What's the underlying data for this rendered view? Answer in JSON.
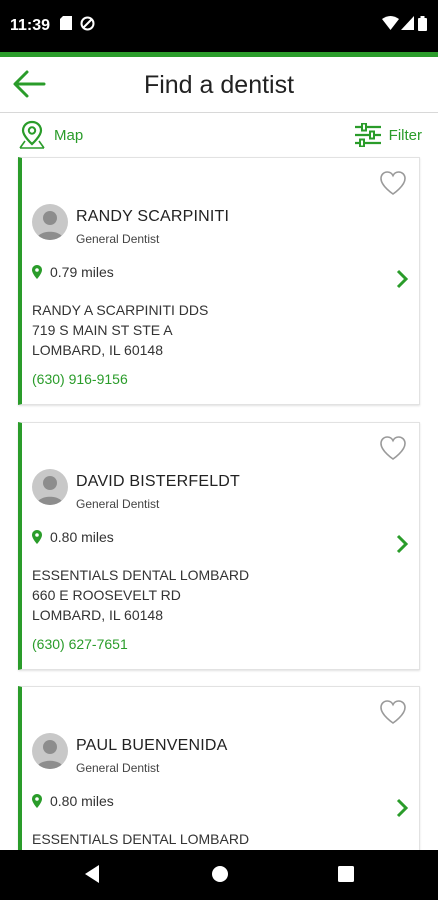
{
  "status_bar": {
    "time": "11:39"
  },
  "header": {
    "title": "Find a dentist"
  },
  "toolbar": {
    "map_label": "Map",
    "filter_label": "Filter"
  },
  "colors": {
    "accent": "#2a9c2a"
  },
  "dentists": [
    {
      "name": "RANDY SCARPINITI",
      "specialty": "General Dentist",
      "distance": "0.79 miles",
      "practice": "RANDY A SCARPINITI DDS",
      "street": "719 S MAIN ST STE A",
      "city": "LOMBARD, IL 60148",
      "phone": "(630) 916-9156"
    },
    {
      "name": "DAVID BISTERFELDT",
      "specialty": "General Dentist",
      "distance": "0.80 miles",
      "practice": "ESSENTIALS DENTAL LOMBARD",
      "street": "660 E ROOSEVELT RD",
      "city": "LOMBARD, IL 60148",
      "phone": "(630) 627-7651"
    },
    {
      "name": "PAUL BUENVENIDA",
      "specialty": "General Dentist",
      "distance": "0.80 miles",
      "practice": "ESSENTIALS DENTAL LOMBARD"
    }
  ]
}
